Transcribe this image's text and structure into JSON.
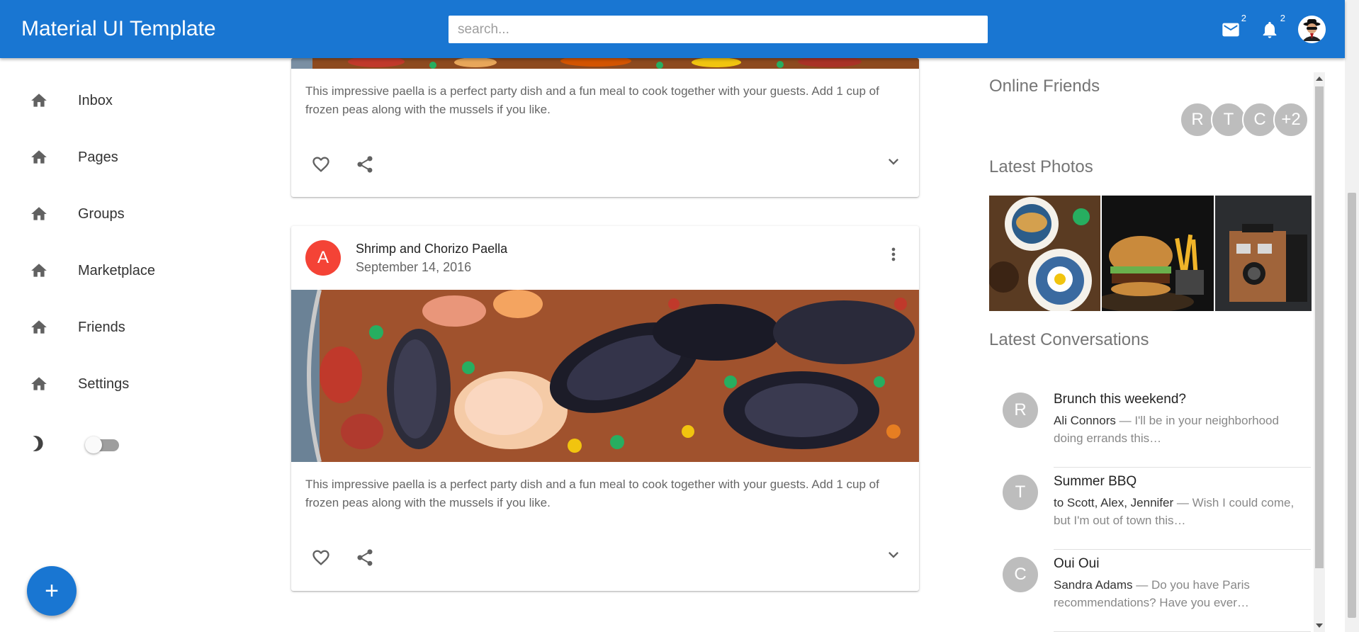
{
  "appbar": {
    "title": "Material UI Template",
    "search_placeholder": "search...",
    "mail_badge": "2",
    "notifications_badge": "2",
    "brand_color": "#1976d2"
  },
  "sidebar": {
    "items": [
      {
        "label": "Inbox",
        "icon": "home-icon"
      },
      {
        "label": "Pages",
        "icon": "home-icon"
      },
      {
        "label": "Groups",
        "icon": "home-icon"
      },
      {
        "label": "Marketplace",
        "icon": "home-icon"
      },
      {
        "label": "Friends",
        "icon": "home-icon"
      },
      {
        "label": "Settings",
        "icon": "home-icon"
      }
    ],
    "dark_mode_enabled": false,
    "fab_label": "+"
  },
  "cards": [
    {
      "text": "This impressive paella is a perfect party dish and a fun meal to cook together with your guests. Add 1 cup of frozen peas along with the mussels if you like."
    },
    {
      "avatar_letter": "A",
      "avatar_color": "#f44336",
      "title": "Shrimp and Chorizo Paella",
      "date": "September 14, 2016",
      "text": "This impressive paella is a perfect party dish and a fun meal to cook together with your guests. Add 1 cup of frozen peas along with the mussels if you like."
    }
  ],
  "right_panel": {
    "online_friends_title": "Online Friends",
    "friends": [
      "R",
      "T",
      "C",
      "+2"
    ],
    "latest_photos_title": "Latest Photos",
    "photos": [
      "breakfast-plates-photo",
      "burger-fries-photo",
      "vintage-camera-photo"
    ],
    "latest_conversations_title": "Latest Conversations",
    "conversations": [
      {
        "avatar": "R",
        "title": "Brunch this weekend?",
        "who": "Ali Connors",
        "snippet": " — I'll be in your neighborhood doing errands this…"
      },
      {
        "avatar": "T",
        "title": "Summer BBQ",
        "who": "to Scott, Alex, Jennifer",
        "snippet": " — Wish I could come, but I'm out of town this…"
      },
      {
        "avatar": "C",
        "title": "Oui Oui",
        "who": "Sandra Adams",
        "snippet": " — Do you have Paris recommendations? Have you ever…"
      }
    ]
  }
}
